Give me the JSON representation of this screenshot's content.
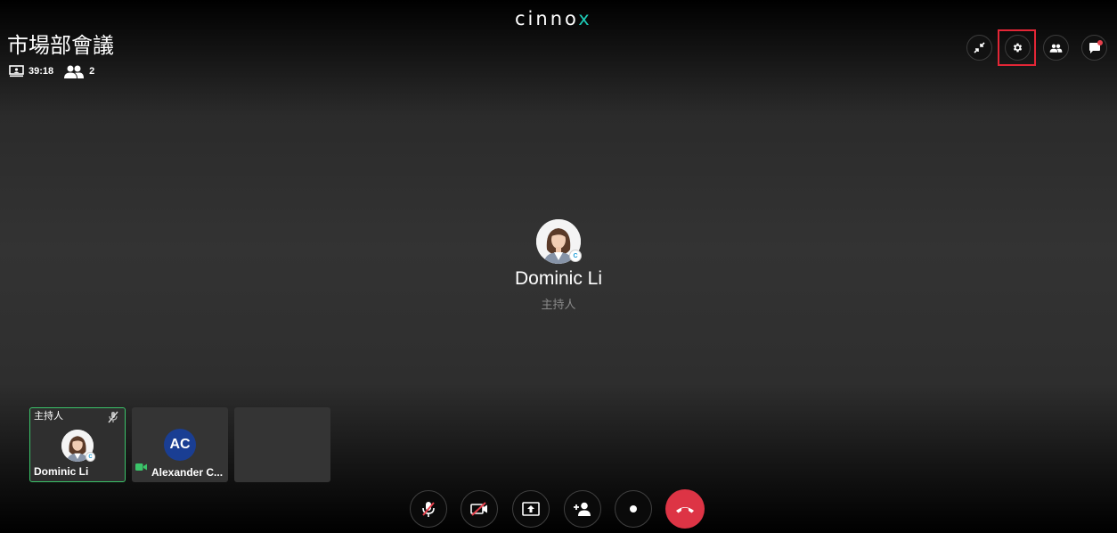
{
  "app": {
    "logo_text": "cinno",
    "logo_accent": "x"
  },
  "meeting": {
    "title": "市場部會議",
    "duration": "39:18",
    "participant_count": "2"
  },
  "top_controls": [
    {
      "name": "collapse-view-button",
      "icon": "collapse-icon"
    },
    {
      "name": "settings-button",
      "icon": "gear-icon",
      "highlighted": true
    },
    {
      "name": "participants-button",
      "icon": "people-icon"
    },
    {
      "name": "chat-button",
      "icon": "chat-icon",
      "has_notification": true
    }
  ],
  "active_speaker": {
    "name": "Dominic Li",
    "role": "主持人"
  },
  "tiles": [
    {
      "name": "Dominic Li",
      "role": "主持人",
      "muted": true,
      "active": true
    },
    {
      "name": "Alexander C...",
      "initials": "AC",
      "camera_on": true
    },
    {
      "name": "",
      "empty": true
    }
  ],
  "bottom_controls": [
    {
      "name": "mute-button",
      "icon": "mic-off-icon"
    },
    {
      "name": "video-button",
      "icon": "video-off-icon"
    },
    {
      "name": "share-screen-button",
      "icon": "share-screen-icon"
    },
    {
      "name": "add-participant-button",
      "icon": "add-person-icon"
    },
    {
      "name": "record-button",
      "icon": "record-icon"
    },
    {
      "name": "end-call-button",
      "icon": "hang-up-icon"
    }
  ],
  "colors": {
    "accent": "#1ec8b4",
    "highlight_border": "#e32636",
    "end_call": "#dd3445",
    "active_tile_border": "#3bc46a",
    "avatar_bg": "#1a3e93"
  }
}
